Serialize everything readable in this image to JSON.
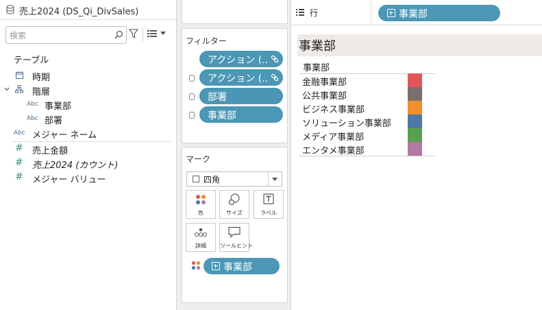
{
  "datasource": {
    "name": "売上2024 (DS_Qi_DivSales)"
  },
  "search": {
    "placeholder": "検索"
  },
  "tables_heading": "テーブル",
  "fields": [
    {
      "name": "時期",
      "icon": "calendar-icon"
    },
    {
      "name": "階層",
      "icon": "hierarchy-icon"
    },
    {
      "name": "事業部",
      "icon": "abc-icon"
    },
    {
      "name": "部署",
      "icon": "abc-icon"
    },
    {
      "name": "メジャー ネーム",
      "icon": "abc-icon"
    },
    {
      "name": "売上金額",
      "icon": "measure-icon"
    },
    {
      "name": "売上2024 (カウント)",
      "icon": "measure-icon"
    },
    {
      "name": "メジャー バリュー",
      "icon": "measure-icon"
    }
  ],
  "field_type_abbr": "Abc",
  "filters": {
    "title": "フィルター",
    "pills": [
      "アクション (..",
      "アクション (..",
      "部署",
      "事業部"
    ]
  },
  "marks": {
    "title": "マーク",
    "type": "四角",
    "buttons": {
      "color": "色",
      "size": "サイズ",
      "label": "ラベル",
      "detail": "詳細",
      "tooltip": "ツールヒント"
    },
    "color_pill": "事業部"
  },
  "rows_shelf": {
    "label": "行",
    "pill": "事業部"
  },
  "viz": {
    "title": "事業部",
    "column_header": "事業部",
    "items": [
      {
        "label": "金融事業部",
        "color": "#e15759"
      },
      {
        "label": "公共事業部",
        "color": "#79706e"
      },
      {
        "label": "ビジネス事業部",
        "color": "#f28e2b"
      },
      {
        "label": "ソリューション事業部",
        "color": "#4e79a7"
      },
      {
        "label": "メディア事業部",
        "color": "#59a14f"
      },
      {
        "label": "エンタメ事業部",
        "color": "#b07aa1"
      }
    ]
  },
  "colors": {
    "pill": "#4b97b5"
  }
}
